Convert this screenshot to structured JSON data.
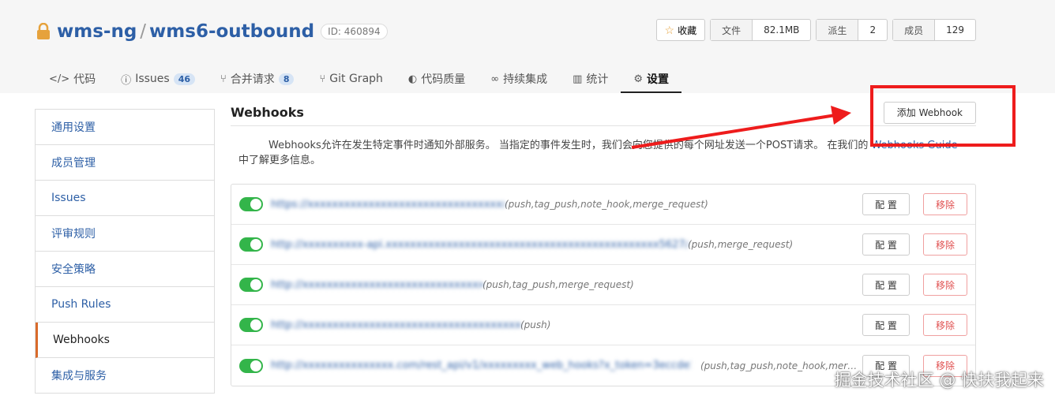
{
  "repo": {
    "namespace": "wms-ng",
    "separator": "/",
    "name": "wms6-outbound",
    "id_label": "ID: 460894"
  },
  "stats": {
    "star_label": "收藏",
    "files_label": "文件",
    "files_value": "82.1MB",
    "forks_label": "派生",
    "forks_value": "2",
    "members_label": "成员",
    "members_value": "129"
  },
  "tabs": [
    {
      "icon": "</>",
      "label": "代码"
    },
    {
      "icon": "ⓘ",
      "label": "Issues",
      "badge": "46"
    },
    {
      "icon": "⑂",
      "label": "合并请求",
      "badge": "8"
    },
    {
      "icon": "⑂",
      "label": "Git Graph"
    },
    {
      "icon": "◐",
      "label": "代码质量"
    },
    {
      "icon": "∞",
      "label": "持续集成"
    },
    {
      "icon": "▥",
      "label": "统计"
    },
    {
      "icon": "⚙",
      "label": "设置"
    }
  ],
  "sidebar": {
    "items": [
      {
        "label": "通用设置"
      },
      {
        "label": "成员管理"
      },
      {
        "label": "Issues"
      },
      {
        "label": "评审规则"
      },
      {
        "label": "安全策略"
      },
      {
        "label": "Push Rules"
      },
      {
        "label": "Webhooks"
      },
      {
        "label": "集成与服务"
      }
    ]
  },
  "main": {
    "title": "Webhooks",
    "add_button": "添加 Webhook",
    "description_text": "Webhooks允许在发生特定事件时通知外部服务。 当指定的事件发生时，我们会向您提供的每个网址发送一个POST请求。 在我们的",
    "description_link": "Webhooks Guide",
    "description_suffix": "中了解更多信息。",
    "config_label": "配 置",
    "delete_label": "移除",
    "hooks": [
      {
        "url": "https://xxxxxxxxxxxxxxxxxxxxxxxxxxxxxxxxxxxxxxxxxxxsits",
        "events": "(push,tag_push,note_hook,merge_request)"
      },
      {
        "url": "http://xxxxxxxxxx-api.xxxxxxxxxxxxxxxxxxxxxxxxxxxxxxxxxxxxxxxxxxxxx5627/3470",
        "events": "(push,merge_request)"
      },
      {
        "url": "http://xxxxxxxxxxxxxxxxxxxxxxxxxxxxxxxxxxk",
        "events": "(push,tag_push,merge_request)"
      },
      {
        "url": "http://xxxxxxxxxxxxxxxxxxxxxxxxxxxxxxxxxxxxxxxxxxxxxxxk",
        "events": "(push)"
      },
      {
        "url": "http://xxxxxxxxxxxxxxx.com/rest_api/v1/xxxxxxxxx_web_hooks?x_token=3eccde5cf1x2",
        "events": "(push,tag_push,note_hook,merg..."
      }
    ]
  },
  "watermark": "掘金技术社区 @ 快扶我起来",
  "colors": {
    "accent_blue": "#2d5fa6",
    "toggle_on": "#33b54a",
    "danger": "#e05050",
    "annotation_red": "#ee1c1c",
    "active_tab_marker": "#d96b2b"
  }
}
